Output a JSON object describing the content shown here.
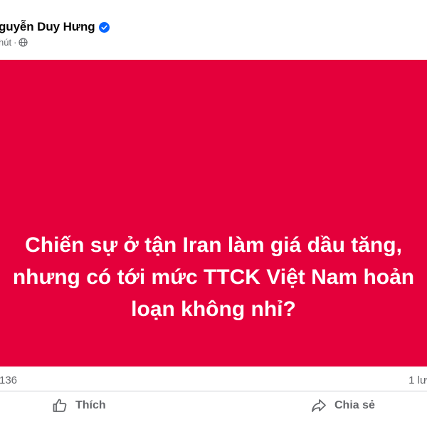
{
  "post": {
    "author_name": "guyễn Duy Hưng",
    "time_text": "hút",
    "visibility_icon": "globe-icon",
    "verified_icon": "verified-badge-icon",
    "image_text_lines": [
      "Chiến sự ở tận Iran làm giá dầu tăng,",
      "nhưng có tới mức TTCK Việt Nam hoản",
      "loạn không nhỉ?"
    ],
    "image_background": "#e4003b"
  },
  "stats": {
    "reactions_count": "136",
    "comments_count": "1 lư"
  },
  "actions": {
    "like_label": "Thích",
    "share_label": "Chia sẻ"
  },
  "colors": {
    "accent": "#0866ff",
    "muted_text": "#65676b"
  }
}
